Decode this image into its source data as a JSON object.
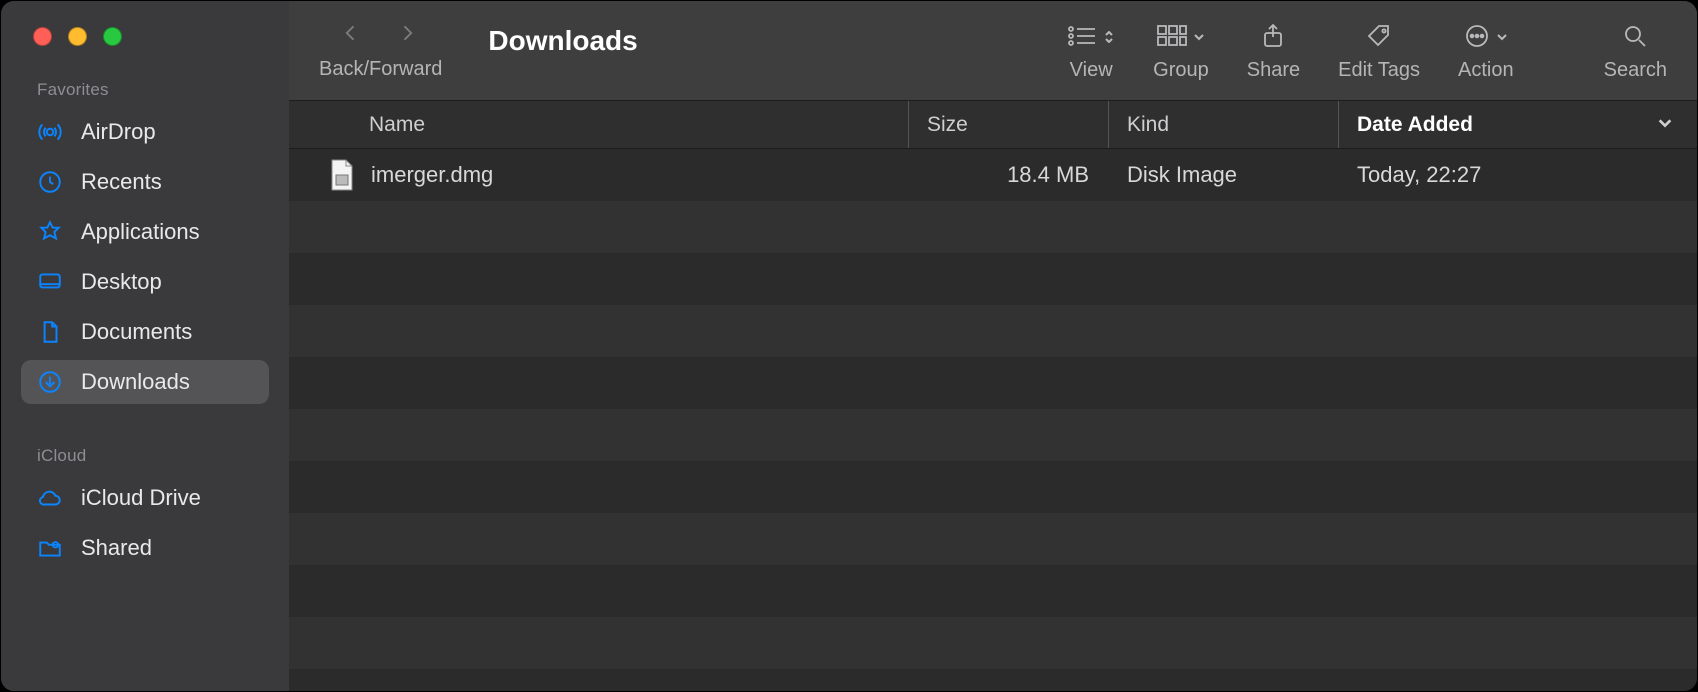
{
  "window_title": "Downloads",
  "toolbar": {
    "back_forward_label": "Back/Forward",
    "view_label": "View",
    "group_label": "Group",
    "share_label": "Share",
    "edit_tags_label": "Edit Tags",
    "action_label": "Action",
    "search_label": "Search"
  },
  "sidebar": {
    "sections": [
      {
        "title": "Favorites",
        "items": [
          {
            "id": "airdrop",
            "label": "AirDrop"
          },
          {
            "id": "recents",
            "label": "Recents"
          },
          {
            "id": "applications",
            "label": "Applications"
          },
          {
            "id": "desktop",
            "label": "Desktop"
          },
          {
            "id": "documents",
            "label": "Documents"
          },
          {
            "id": "downloads",
            "label": "Downloads",
            "selected": true
          }
        ]
      },
      {
        "title": "iCloud",
        "items": [
          {
            "id": "icloud-drive",
            "label": "iCloud Drive"
          },
          {
            "id": "shared",
            "label": "Shared"
          }
        ]
      }
    ]
  },
  "columns": {
    "name": "Name",
    "size": "Size",
    "kind": "Kind",
    "date_added": "Date Added"
  },
  "files": [
    {
      "name": "imerger.dmg",
      "size": "18.4 MB",
      "kind": "Disk Image",
      "date_added": "Today, 22:27"
    }
  ]
}
